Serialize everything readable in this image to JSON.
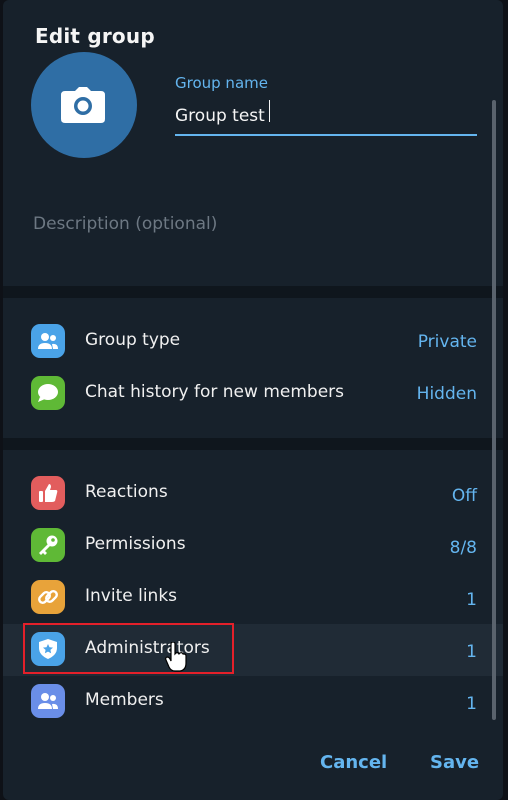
{
  "dialog": {
    "title": "Edit group",
    "group_name_label": "Group name",
    "group_name_value": "Group test",
    "description_placeholder": "Description (optional)"
  },
  "settings": [
    {
      "label": "Group type",
      "value": "Private",
      "icon": "group-type-icon",
      "color": "#4aa3e8"
    },
    {
      "label": "Chat history for new members",
      "value": "Hidden",
      "icon": "chat-bubble-icon",
      "color": "#5fb936"
    }
  ],
  "management": [
    {
      "label": "Reactions",
      "value": "Off",
      "icon": "thumbs-up-icon",
      "color": "#e25d5d"
    },
    {
      "label": "Permissions",
      "value": "8/8",
      "icon": "key-icon",
      "color": "#5fb936"
    },
    {
      "label": "Invite links",
      "value": "1",
      "icon": "link-icon",
      "color": "#e8a33a"
    },
    {
      "label": "Administrators",
      "value": "1",
      "icon": "admin-shield-icon",
      "color": "#4aa3e8"
    },
    {
      "label": "Members",
      "value": "1",
      "icon": "members-icon",
      "color": "#6a8ee8"
    }
  ],
  "buttons": {
    "cancel": "Cancel",
    "save": "Save"
  }
}
